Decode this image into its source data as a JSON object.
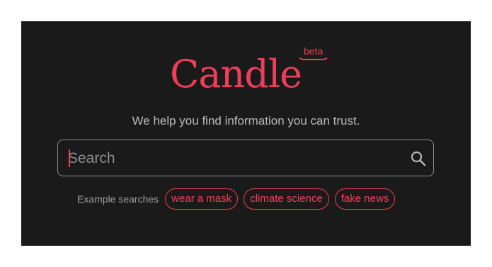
{
  "brand": {
    "name": "Candle",
    "badge": "beta",
    "tagline": "We help you find information you can trust."
  },
  "search": {
    "placeholder": "Search",
    "value": ""
  },
  "examples": {
    "label": "Example searches",
    "items": [
      "wear a mask",
      "climate science",
      "fake news"
    ]
  },
  "icons": {
    "search": "search-icon"
  },
  "colors": {
    "background": "#1b1a1b",
    "accent": "#ef3f58",
    "text_muted": "#b9b9b9",
    "border": "#8d8d8d"
  }
}
